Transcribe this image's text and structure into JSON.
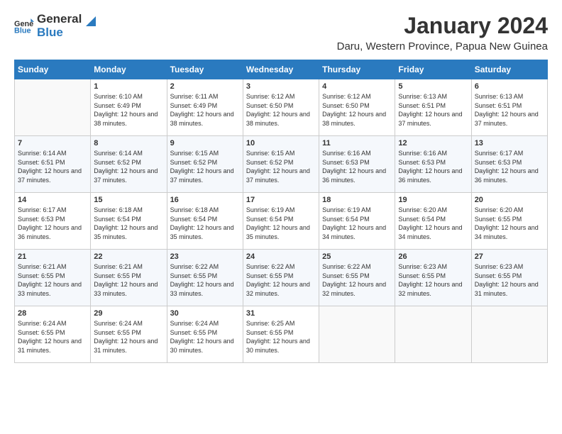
{
  "header": {
    "logo_general": "General",
    "logo_blue": "Blue",
    "month_year": "January 2024",
    "location": "Daru, Western Province, Papua New Guinea"
  },
  "days_of_week": [
    "Sunday",
    "Monday",
    "Tuesday",
    "Wednesday",
    "Thursday",
    "Friday",
    "Saturday"
  ],
  "weeks": [
    {
      "days": [
        {
          "num": "",
          "sunrise": "",
          "sunset": "",
          "daylight": ""
        },
        {
          "num": "1",
          "sunrise": "Sunrise: 6:10 AM",
          "sunset": "Sunset: 6:49 PM",
          "daylight": "Daylight: 12 hours and 38 minutes."
        },
        {
          "num": "2",
          "sunrise": "Sunrise: 6:11 AM",
          "sunset": "Sunset: 6:49 PM",
          "daylight": "Daylight: 12 hours and 38 minutes."
        },
        {
          "num": "3",
          "sunrise": "Sunrise: 6:12 AM",
          "sunset": "Sunset: 6:50 PM",
          "daylight": "Daylight: 12 hours and 38 minutes."
        },
        {
          "num": "4",
          "sunrise": "Sunrise: 6:12 AM",
          "sunset": "Sunset: 6:50 PM",
          "daylight": "Daylight: 12 hours and 38 minutes."
        },
        {
          "num": "5",
          "sunrise": "Sunrise: 6:13 AM",
          "sunset": "Sunset: 6:51 PM",
          "daylight": "Daylight: 12 hours and 37 minutes."
        },
        {
          "num": "6",
          "sunrise": "Sunrise: 6:13 AM",
          "sunset": "Sunset: 6:51 PM",
          "daylight": "Daylight: 12 hours and 37 minutes."
        }
      ]
    },
    {
      "days": [
        {
          "num": "7",
          "sunrise": "Sunrise: 6:14 AM",
          "sunset": "Sunset: 6:51 PM",
          "daylight": "Daylight: 12 hours and 37 minutes."
        },
        {
          "num": "8",
          "sunrise": "Sunrise: 6:14 AM",
          "sunset": "Sunset: 6:52 PM",
          "daylight": "Daylight: 12 hours and 37 minutes."
        },
        {
          "num": "9",
          "sunrise": "Sunrise: 6:15 AM",
          "sunset": "Sunset: 6:52 PM",
          "daylight": "Daylight: 12 hours and 37 minutes."
        },
        {
          "num": "10",
          "sunrise": "Sunrise: 6:15 AM",
          "sunset": "Sunset: 6:52 PM",
          "daylight": "Daylight: 12 hours and 37 minutes."
        },
        {
          "num": "11",
          "sunrise": "Sunrise: 6:16 AM",
          "sunset": "Sunset: 6:53 PM",
          "daylight": "Daylight: 12 hours and 36 minutes."
        },
        {
          "num": "12",
          "sunrise": "Sunrise: 6:16 AM",
          "sunset": "Sunset: 6:53 PM",
          "daylight": "Daylight: 12 hours and 36 minutes."
        },
        {
          "num": "13",
          "sunrise": "Sunrise: 6:17 AM",
          "sunset": "Sunset: 6:53 PM",
          "daylight": "Daylight: 12 hours and 36 minutes."
        }
      ]
    },
    {
      "days": [
        {
          "num": "14",
          "sunrise": "Sunrise: 6:17 AM",
          "sunset": "Sunset: 6:53 PM",
          "daylight": "Daylight: 12 hours and 36 minutes."
        },
        {
          "num": "15",
          "sunrise": "Sunrise: 6:18 AM",
          "sunset": "Sunset: 6:54 PM",
          "daylight": "Daylight: 12 hours and 35 minutes."
        },
        {
          "num": "16",
          "sunrise": "Sunrise: 6:18 AM",
          "sunset": "Sunset: 6:54 PM",
          "daylight": "Daylight: 12 hours and 35 minutes."
        },
        {
          "num": "17",
          "sunrise": "Sunrise: 6:19 AM",
          "sunset": "Sunset: 6:54 PM",
          "daylight": "Daylight: 12 hours and 35 minutes."
        },
        {
          "num": "18",
          "sunrise": "Sunrise: 6:19 AM",
          "sunset": "Sunset: 6:54 PM",
          "daylight": "Daylight: 12 hours and 34 minutes."
        },
        {
          "num": "19",
          "sunrise": "Sunrise: 6:20 AM",
          "sunset": "Sunset: 6:54 PM",
          "daylight": "Daylight: 12 hours and 34 minutes."
        },
        {
          "num": "20",
          "sunrise": "Sunrise: 6:20 AM",
          "sunset": "Sunset: 6:55 PM",
          "daylight": "Daylight: 12 hours and 34 minutes."
        }
      ]
    },
    {
      "days": [
        {
          "num": "21",
          "sunrise": "Sunrise: 6:21 AM",
          "sunset": "Sunset: 6:55 PM",
          "daylight": "Daylight: 12 hours and 33 minutes."
        },
        {
          "num": "22",
          "sunrise": "Sunrise: 6:21 AM",
          "sunset": "Sunset: 6:55 PM",
          "daylight": "Daylight: 12 hours and 33 minutes."
        },
        {
          "num": "23",
          "sunrise": "Sunrise: 6:22 AM",
          "sunset": "Sunset: 6:55 PM",
          "daylight": "Daylight: 12 hours and 33 minutes."
        },
        {
          "num": "24",
          "sunrise": "Sunrise: 6:22 AM",
          "sunset": "Sunset: 6:55 PM",
          "daylight": "Daylight: 12 hours and 32 minutes."
        },
        {
          "num": "25",
          "sunrise": "Sunrise: 6:22 AM",
          "sunset": "Sunset: 6:55 PM",
          "daylight": "Daylight: 12 hours and 32 minutes."
        },
        {
          "num": "26",
          "sunrise": "Sunrise: 6:23 AM",
          "sunset": "Sunset: 6:55 PM",
          "daylight": "Daylight: 12 hours and 32 minutes."
        },
        {
          "num": "27",
          "sunrise": "Sunrise: 6:23 AM",
          "sunset": "Sunset: 6:55 PM",
          "daylight": "Daylight: 12 hours and 31 minutes."
        }
      ]
    },
    {
      "days": [
        {
          "num": "28",
          "sunrise": "Sunrise: 6:24 AM",
          "sunset": "Sunset: 6:55 PM",
          "daylight": "Daylight: 12 hours and 31 minutes."
        },
        {
          "num": "29",
          "sunrise": "Sunrise: 6:24 AM",
          "sunset": "Sunset: 6:55 PM",
          "daylight": "Daylight: 12 hours and 31 minutes."
        },
        {
          "num": "30",
          "sunrise": "Sunrise: 6:24 AM",
          "sunset": "Sunset: 6:55 PM",
          "daylight": "Daylight: 12 hours and 30 minutes."
        },
        {
          "num": "31",
          "sunrise": "Sunrise: 6:25 AM",
          "sunset": "Sunset: 6:55 PM",
          "daylight": "Daylight: 12 hours and 30 minutes."
        },
        {
          "num": "",
          "sunrise": "",
          "sunset": "",
          "daylight": ""
        },
        {
          "num": "",
          "sunrise": "",
          "sunset": "",
          "daylight": ""
        },
        {
          "num": "",
          "sunrise": "",
          "sunset": "",
          "daylight": ""
        }
      ]
    }
  ]
}
